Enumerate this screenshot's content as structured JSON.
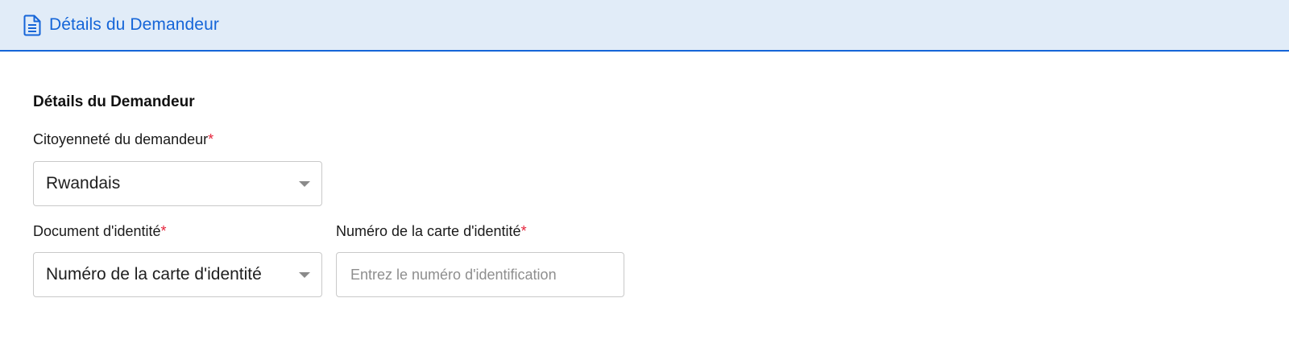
{
  "header": {
    "icon": "document-icon",
    "title": "Détails du Demandeur",
    "accent_color": "#1565d8",
    "background_color": "#e1ecf8"
  },
  "section": {
    "title": "Détails du Demandeur"
  },
  "fields": {
    "citizenship": {
      "label": "Citoyenneté du demandeur",
      "required_mark": "*",
      "value": "Rwandais"
    },
    "id_document": {
      "label": "Document d'identité",
      "required_mark": "*",
      "value": "Numéro de la carte d'identité"
    },
    "id_number": {
      "label": "Numéro de la carte d'identité",
      "required_mark": "*",
      "value": "",
      "placeholder": "Entrez le numéro d'identification"
    }
  },
  "required_color": "#e5243b"
}
